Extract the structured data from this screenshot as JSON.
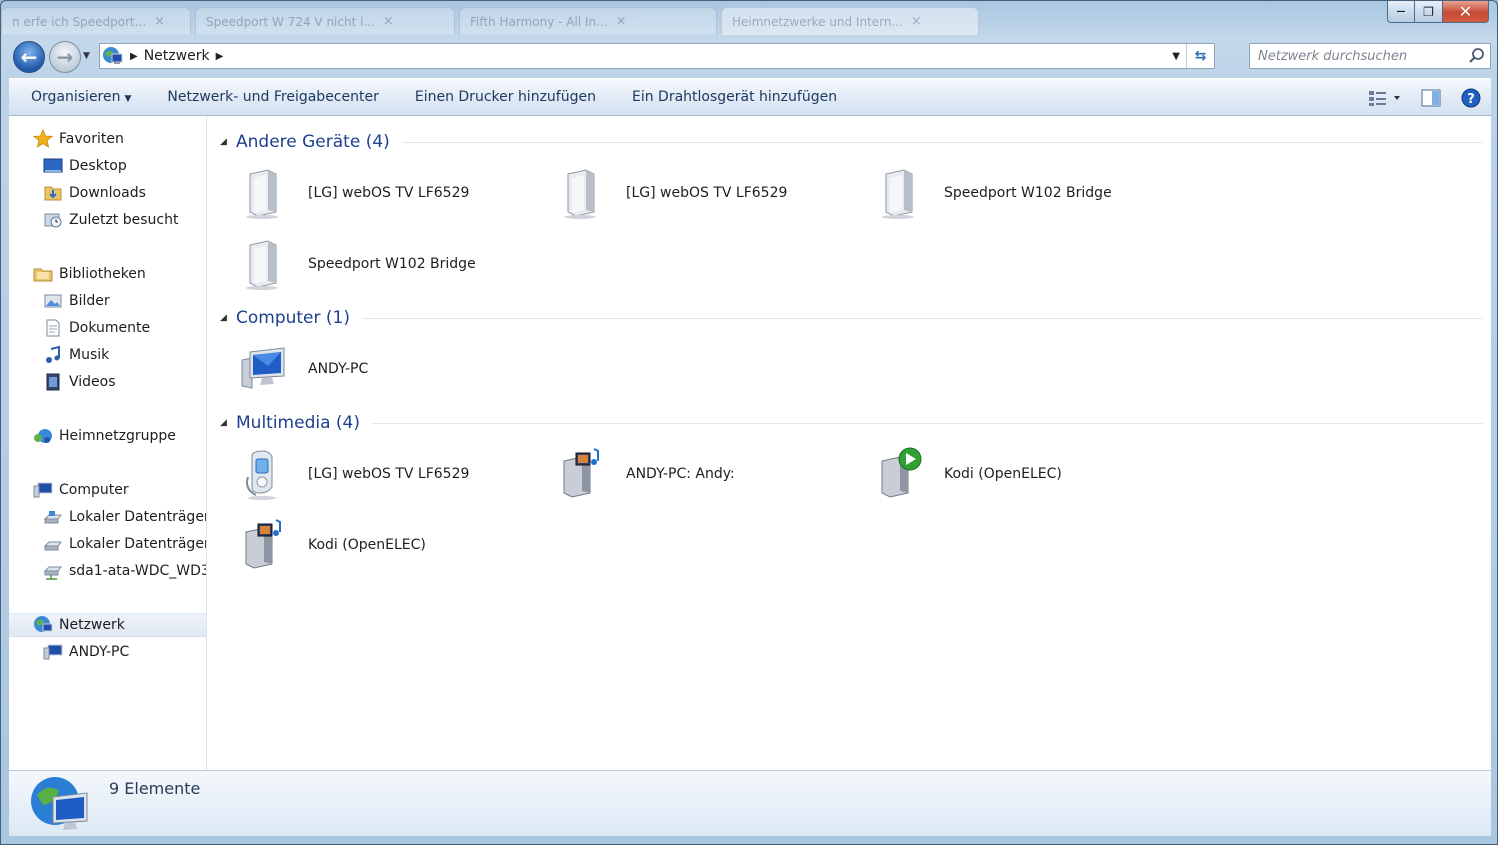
{
  "window": {
    "bg_tabs": [
      {
        "label": "n erfe ich Speedport..."
      },
      {
        "label": "Speedport W 724 V nicht i..."
      },
      {
        "label": "Fifth Harmony - All In..."
      },
      {
        "label": "Heimnetzwerke und Intern..."
      }
    ],
    "close_glyph": "✕",
    "maximize_glyph": "❐",
    "minimize_glyph": "—"
  },
  "address": {
    "path": "Netzwerk",
    "search_placeholder": "Netzwerk durchsuchen"
  },
  "toolbar": {
    "organize": "Organisieren",
    "network_center": "Netzwerk- und Freigabecenter",
    "add_printer": "Einen Drucker hinzufügen",
    "add_wireless": "Ein Drahtlosgerät hinzufügen"
  },
  "nav": {
    "favorites": "Favoriten",
    "desktop": "Desktop",
    "downloads": "Downloads",
    "recent": "Zuletzt besucht",
    "libraries": "Bibliotheken",
    "pictures": "Bilder",
    "documents": "Dokumente",
    "music": "Musik",
    "videos": "Videos",
    "homegroup": "Heimnetzgruppe",
    "computer": "Computer",
    "local_disk_1": "Lokaler Datenträger",
    "local_disk_2": "Lokaler Datenträger",
    "sda1": "sda1-ata-WDC_WD3",
    "network": "Netzwerk",
    "andy_pc": "ANDY-PC"
  },
  "groups": {
    "other": {
      "title": "Andere Geräte (4)",
      "items": [
        "[LG] webOS TV LF6529",
        "[LG] webOS TV LF6529",
        "Speedport W102 Bridge",
        "Speedport W102 Bridge"
      ]
    },
    "computer": {
      "title": "Computer (1)",
      "items": [
        "ANDY-PC"
      ]
    },
    "multimedia": {
      "title": "Multimedia (4)",
      "items": [
        "[LG] webOS TV LF6529",
        "ANDY-PC: Andy:",
        "Kodi (OpenELEC)",
        "Kodi (OpenELEC)"
      ]
    }
  },
  "status": {
    "count": "9 Elemente"
  },
  "colors": {
    "accent": "#1e3f8e",
    "toolbar_text": "#1e3960",
    "frame": "#bcd3e8"
  }
}
